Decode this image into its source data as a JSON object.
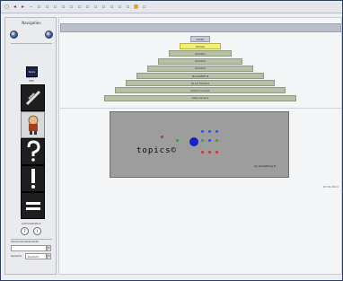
{
  "sidebar": {
    "title": "Navigation",
    "logo": {
      "text": "topics",
      "caption_line1": "topics©",
      "caption_line2": "MM"
    },
    "tools": [
      {
        "name": "pencil",
        "icon": "pencil-icon"
      },
      {
        "name": "character",
        "icon": "character-icon"
      },
      {
        "name": "question",
        "icon": "question-icon"
      },
      {
        "name": "exclamation",
        "icon": "exclamation-icon"
      },
      {
        "name": "equals",
        "icon": "equals-icon"
      }
    ],
    "section_label": "Administration",
    "field1": {
      "label": "Version/Ausbaustufe",
      "value": ""
    },
    "field2": {
      "label": "Sprache",
      "value": "Deutsch"
    }
  },
  "pyramid": [
    "LEVEL",
    "Modell",
    "Modell1",
    "Modell2",
    "Modell3",
    "ModellE2P B",
    "DI-LO Model1",
    "added model1",
    "Alles Level 1"
  ],
  "banner": {
    "title": "topics©",
    "footer": "by something D"
  },
  "stamp": "07.01.2011",
  "colors": {
    "accent_blue": "#1a20c8",
    "dot_red": "#d03030",
    "dot_green": "#30a030",
    "dot_blue": "#3050e0",
    "highlight": "#f2f07a",
    "pyramid_row": "#b6c0a4"
  }
}
